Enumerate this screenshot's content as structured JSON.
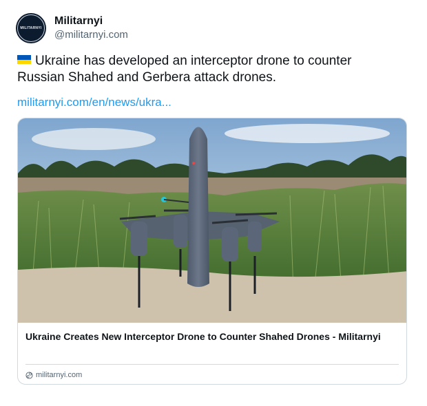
{
  "author": {
    "display_name": "Militarnyi",
    "handle": "@militarnyi.com",
    "avatar_text": "MILITARNYI"
  },
  "post": {
    "flag_icon": "ukraine-flag-icon",
    "text_line1": "Ukraine has developed an interceptor drone to counter",
    "text_line2": "Russian Shahed and Gerbera attack drones.",
    "link_text": "militarnyi.com/en/news/ukra..."
  },
  "card": {
    "title": "Ukraine Creates New Interceptor Drone to Counter Shahed Drones - Militarnyi",
    "domain": "militarnyi.com",
    "domain_icon": "link-icon"
  },
  "colors": {
    "link": "#1d9bf0",
    "text": "#0f1419",
    "muted": "#536471",
    "border": "#cfd9de",
    "avatar_bg": "#0d1b2e"
  }
}
